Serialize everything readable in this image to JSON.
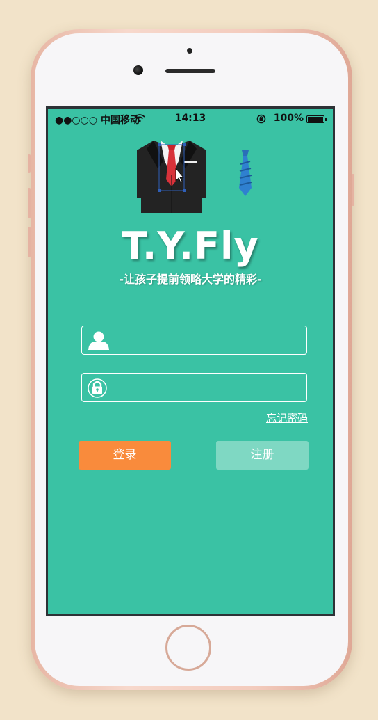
{
  "status_bar": {
    "carrier": "●●○○○ 中国移动",
    "wifi_icon": "wifi-icon",
    "time": "14:13",
    "battery_percent": "100%"
  },
  "branding": {
    "title": "T.Y.Fly",
    "subtitle": "-让孩子提前领略大学的精彩-"
  },
  "form": {
    "username": {
      "icon": "user-icon",
      "value": "",
      "placeholder": ""
    },
    "password": {
      "icon": "lock-icon",
      "value": "",
      "placeholder": ""
    },
    "forgot_label": "忘记密码"
  },
  "buttons": {
    "login_label": "登录",
    "register_label": "注册"
  },
  "colors": {
    "screen_bg": "#3ac2a4",
    "login_btn": "#f98b3c",
    "register_btn": "#7fd8c3",
    "page_bg": "#f2e3c9"
  }
}
